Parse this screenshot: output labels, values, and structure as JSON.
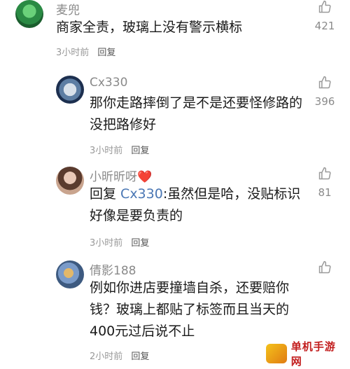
{
  "comments": [
    {
      "username": "麦兜",
      "text": "商家全责，玻璃上没有警示横标",
      "time": "3小时前",
      "reply_label": "回复",
      "likes": "421",
      "avatar_icon": "cartoon-avatar-icon"
    },
    {
      "username": "Cx330",
      "text": "那你走路摔倒了是不是还要怪修路的没把路修好",
      "time": "3小时前",
      "reply_label": "回复",
      "likes": "396",
      "avatar_icon": "moon-avatar-icon"
    },
    {
      "username": "小昕昕呀",
      "username_emoji": "❤️",
      "text_prefix": "回复 ",
      "mention": "Cx330",
      "text": ":虽然但是哈，没贴标识好像是要负责的",
      "time": "3小时前",
      "reply_label": "回复",
      "likes": "81",
      "avatar_icon": "girl-avatar-icon"
    },
    {
      "username": "倩影188",
      "text": "例如你进店要撞墙自杀，还要赔你钱？玻璃上都贴了标签而且当天的400元过后说不止",
      "time": "2小时前",
      "reply_label": "回复",
      "likes": "",
      "avatar_icon": "photo-avatar-icon"
    }
  ],
  "watermark": {
    "text": "单机手游网"
  },
  "icons": {
    "like": "thumbs-up-icon"
  },
  "colors": {
    "mention": "#4a77b4",
    "muted": "#8a8a8a",
    "heart": "#ff4d6d"
  }
}
